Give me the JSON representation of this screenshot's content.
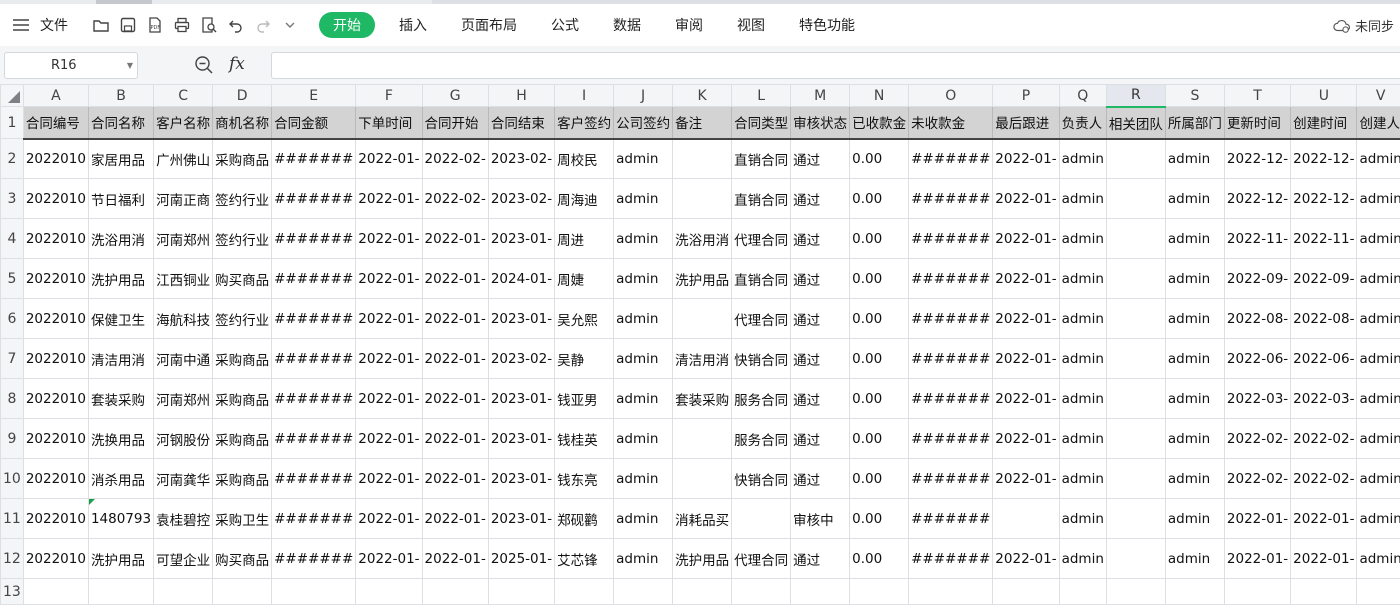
{
  "toolbar": {
    "file_label": "文件",
    "tabs": [
      {
        "label": "开始",
        "active": true
      },
      {
        "label": "插入"
      },
      {
        "label": "页面布局"
      },
      {
        "label": "公式"
      },
      {
        "label": "数据"
      },
      {
        "label": "审阅"
      },
      {
        "label": "视图"
      },
      {
        "label": "特色功能"
      }
    ],
    "sync_label": "未同步",
    "accent_color": "#1fb864"
  },
  "formula_bar": {
    "name_box": "R16",
    "fx_label": "fx",
    "value": ""
  },
  "sheet": {
    "columns": [
      "A",
      "B",
      "C",
      "D",
      "E",
      "F",
      "G",
      "H",
      "I",
      "J",
      "K",
      "L",
      "M",
      "N",
      "O",
      "P",
      "Q",
      "R",
      "S",
      "T",
      "U",
      "V"
    ],
    "selected_column": "R",
    "row_numbers": [
      "1",
      "2",
      "3",
      "4",
      "5",
      "6",
      "7",
      "8",
      "9",
      "10",
      "11",
      "12",
      "13"
    ],
    "header_row": [
      "合同编号",
      "合同名称",
      "客户名称",
      "商机名称",
      "合同金额",
      "下单时间",
      "合同开始",
      "合同结束",
      "客户签约",
      "公司签约",
      "备注",
      "合同类型",
      "审核状态",
      "已收款金",
      "未收款金",
      "最后跟进",
      "负责人",
      "相关团队",
      "所属部门",
      "更新时间",
      "创建时间",
      "创建人"
    ],
    "rows": [
      [
        "2022010",
        "家居用品",
        "广州佛山",
        "采购商品",
        "#######",
        "2022-01-",
        "2022-02-",
        "2023-02-",
        "周校民",
        "admin",
        "",
        "直销合同",
        "通过",
        "0.00",
        "#######",
        "2022-01-",
        "admin",
        "",
        "admin",
        "2022-12-",
        "2022-12-",
        "admin"
      ],
      [
        "2022010",
        "节日福利",
        "河南正商",
        "签约行业",
        "#######",
        "2022-01-",
        "2022-02-",
        "2023-02-",
        "周海迪",
        "admin",
        "",
        "直销合同",
        "通过",
        "0.00",
        "#######",
        "2022-01-",
        "admin",
        "",
        "admin",
        "2022-12-",
        "2022-12-",
        "admin"
      ],
      [
        "2022010",
        "洗浴用消",
        "河南郑州",
        "签约行业",
        "#######",
        "2022-01-",
        "2022-01-",
        "2023-01-",
        "周进",
        "admin",
        "洗浴用消",
        "代理合同",
        "通过",
        "0.00",
        "#######",
        "2022-01-",
        "admin",
        "",
        "admin",
        "2022-11-",
        "2022-11-",
        "admin"
      ],
      [
        "2022010",
        "洗护用品",
        "江西铜业",
        "购买商品",
        "#######",
        "2022-01-",
        "2022-01-",
        "2024-01-",
        "周婕",
        "admin",
        "洗护用品",
        "直销合同",
        "通过",
        "0.00",
        "#######",
        "2022-01-",
        "admin",
        "",
        "admin",
        "2022-09-",
        "2022-09-",
        "admin"
      ],
      [
        "2022010",
        "保健卫生",
        "海航科技",
        "签约行业",
        "#######",
        "2022-01-",
        "2022-01-",
        "2023-01-",
        "吴允熙",
        "admin",
        "",
        "代理合同",
        "通过",
        "0.00",
        "#######",
        "2022-01-",
        "admin",
        "",
        "admin",
        "2022-08-",
        "2022-08-",
        "admin"
      ],
      [
        "2022010",
        "清洁用消",
        "河南中通",
        "采购商品",
        "#######",
        "2022-01-",
        "2022-01-",
        "2023-02-",
        "吴静",
        "admin",
        "清洁用消",
        "快销合同",
        "通过",
        "0.00",
        "#######",
        "2022-01-",
        "admin",
        "",
        "admin",
        "2022-06-",
        "2022-06-",
        "admin"
      ],
      [
        "2022010",
        "套装采购",
        "河南郑州",
        "采购商品",
        "#######",
        "2022-01-",
        "2022-01-",
        "2023-01-",
        "钱亚男",
        "admin",
        "套装采购",
        "服务合同",
        "通过",
        "0.00",
        "#######",
        "2022-01-",
        "admin",
        "",
        "admin",
        "2022-03-",
        "2022-03-",
        "admin"
      ],
      [
        "2022010",
        "洗换用品",
        "河钢股份",
        "采购商品",
        "#######",
        "2022-01-",
        "2022-01-",
        "2023-01-",
        "钱桂英",
        "admin",
        "",
        "服务合同",
        "通过",
        "0.00",
        "#######",
        "2022-01-",
        "admin",
        "",
        "admin",
        "2022-02-",
        "2022-02-",
        "admin"
      ],
      [
        "2022010",
        "消杀用品",
        "河南龚华",
        "采购商品",
        "#######",
        "2022-01-",
        "2022-01-",
        "2023-01-",
        "钱东亮",
        "admin",
        "",
        "快销合同",
        "通过",
        "0.00",
        "#######",
        "2022-01-",
        "admin",
        "",
        "admin",
        "2022-02-",
        "2022-02-",
        "admin"
      ],
      [
        "2022010",
        "1480793",
        "袁桂碧控",
        "采购卫生",
        "#######",
        "2022-01-",
        "2022-01-",
        "2023-01-",
        "郑砚鹳",
        "admin",
        "消耗品买",
        "",
        "审核中",
        "0.00",
        "#######",
        "",
        "admin",
        "",
        "admin",
        "2022-01-",
        "2022-01-",
        "admin"
      ],
      [
        "2022010",
        "洗护用品",
        "可望企业",
        "购买商品",
        "#######",
        "2022-01-",
        "2022-01-",
        "2025-01-",
        "艾芯锋",
        "admin",
        "洗护用品",
        "代理合同",
        "通过",
        "0.00",
        "#######",
        "2022-01-",
        "admin",
        "",
        "admin",
        "2022-01-",
        "2022-01-",
        "admin"
      ],
      [
        "",
        "",
        "",
        "",
        "",
        "",
        "",
        "",
        "",
        "",
        "",
        "",
        "",
        "",
        "",
        "",
        "",
        "",
        "",
        "",
        "",
        ""
      ]
    ]
  }
}
